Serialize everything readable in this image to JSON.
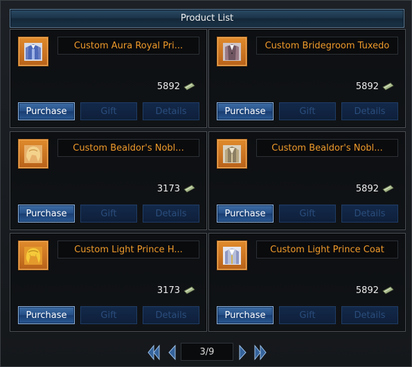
{
  "window": {
    "title": "Product List"
  },
  "buttons": {
    "purchase": "Purchase",
    "gift": "Gift",
    "details": "Details"
  },
  "products": [
    {
      "name": "Custom Aura Royal Pri...",
      "price": "5892",
      "icon": "blue-royal-costume-icon"
    },
    {
      "name": "Custom Bridegroom Tuxedo",
      "price": "5892",
      "icon": "tuxedo-costume-icon"
    },
    {
      "name": "Custom Bealdor's Nobl...",
      "price": "3173",
      "icon": "blonde-hair-icon"
    },
    {
      "name": "Custom Bealdor's Nobl...",
      "price": "5892",
      "icon": "noble-coat-icon"
    },
    {
      "name": "Custom Light Prince H...",
      "price": "3173",
      "icon": "golden-hair-icon"
    },
    {
      "name": "Custom Light Prince Coat",
      "price": "5892",
      "icon": "prince-coat-icon"
    }
  ],
  "pagination": {
    "current_page": 3,
    "total_pages": 9,
    "label": "3/9"
  },
  "colors": {
    "name_text": "#ef9a2a",
    "accent_blue": "#2a5992",
    "thumb_orange": "#e08b2c"
  }
}
